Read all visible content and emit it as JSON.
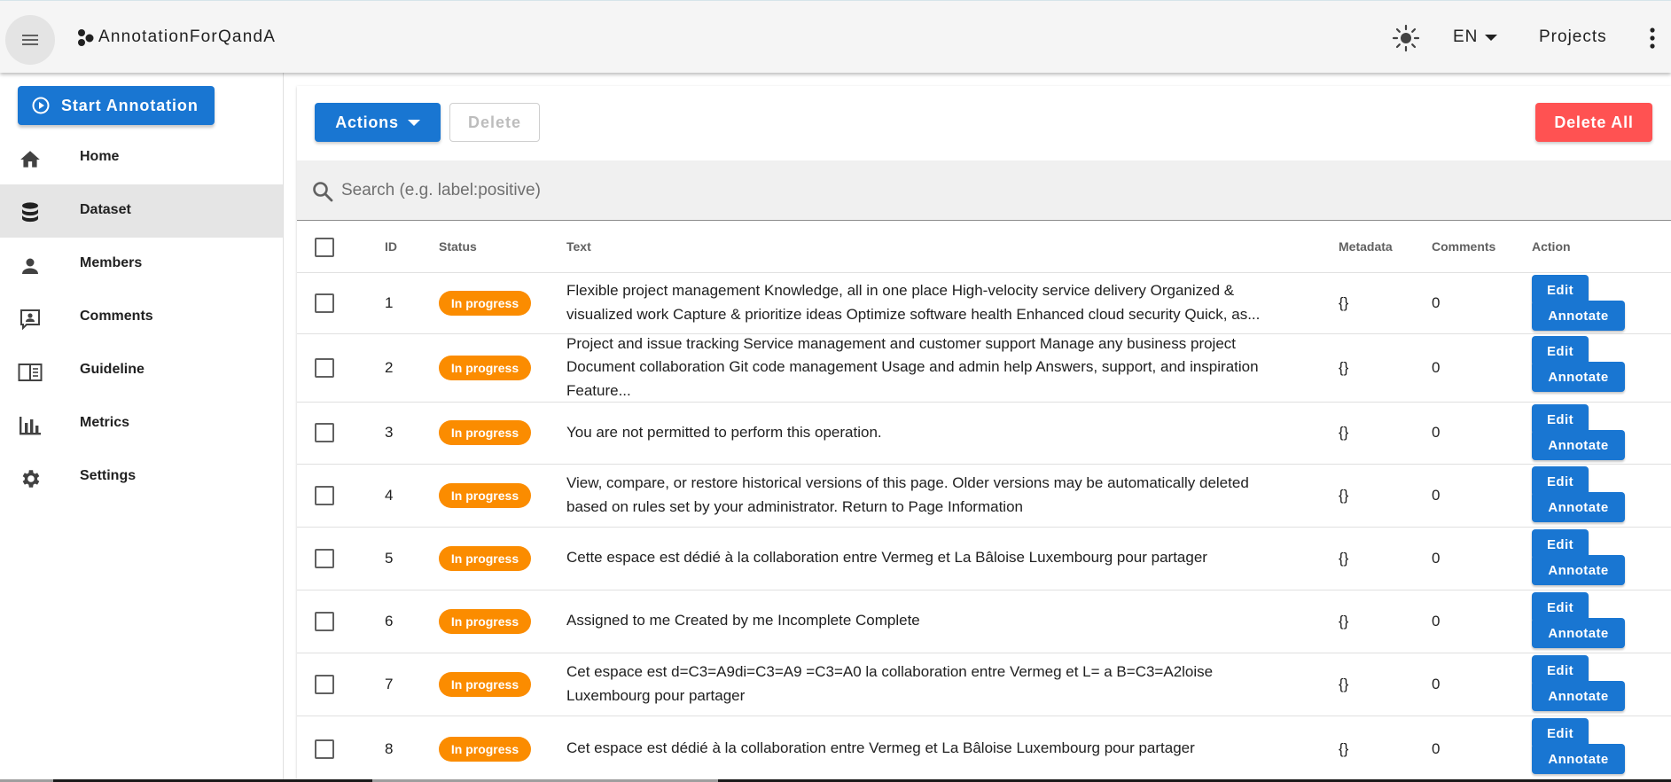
{
  "app": {
    "title": "AnnotationForQandA",
    "language": "EN",
    "projects_label": "Projects"
  },
  "sidebar": {
    "start_button": "Start Annotation",
    "items": [
      {
        "label": "Home",
        "icon": "home-icon"
      },
      {
        "label": "Dataset",
        "icon": "database-icon",
        "active": true
      },
      {
        "label": "Members",
        "icon": "person-icon"
      },
      {
        "label": "Comments",
        "icon": "comment-account-icon"
      },
      {
        "label": "Guideline",
        "icon": "book-open-icon"
      },
      {
        "label": "Metrics",
        "icon": "bar-chart-icon"
      },
      {
        "label": "Settings",
        "icon": "gear-icon"
      }
    ]
  },
  "toolbar": {
    "actions_label": "Actions",
    "delete_label": "Delete",
    "delete_all_label": "Delete All"
  },
  "search": {
    "placeholder": "Search (e.g. label:positive)",
    "value": ""
  },
  "table": {
    "columns": [
      "ID",
      "Status",
      "Text",
      "Metadata",
      "Comments",
      "Action"
    ],
    "edit_label": "Edit",
    "annotate_label": "Annotate",
    "rows": [
      {
        "id": "1",
        "status": "In progress",
        "text": "Flexible project management Knowledge, all in one place High-velocity service delivery Organized & visualized work Capture & prioritize ideas Optimize software health Enhanced cloud security Quick, as...",
        "metadata": "{}",
        "comments": "0"
      },
      {
        "id": "2",
        "status": "In progress",
        "text": "Project and issue tracking Service management and customer support Manage any business project Document collaboration Git code management Usage and admin help Answers, support, and inspiration Feature...",
        "metadata": "{}",
        "comments": "0"
      },
      {
        "id": "3",
        "status": "In progress",
        "text": "You are not permitted to perform this operation.",
        "metadata": "{}",
        "comments": "0"
      },
      {
        "id": "4",
        "status": "In progress",
        "text": "View, compare, or restore historical versions of this page. Older versions may be automatically deleted based on rules set by your administrator. Return to Page Information",
        "metadata": "{}",
        "comments": "0"
      },
      {
        "id": "5",
        "status": "In progress",
        "text": "Cette espace est dédié à la collaboration entre Vermeg et La Bâloise Luxembourg pour partager",
        "metadata": "{}",
        "comments": "0"
      },
      {
        "id": "6",
        "status": "In progress",
        "text": "Assigned to me Created by me Incomplete Complete",
        "metadata": "{}",
        "comments": "0"
      },
      {
        "id": "7",
        "status": "In progress",
        "text": "Cet espace est d=C3=A9di=C3=A9 =C3=A0 la collaboration entre Vermeg et L= a B=C3=A2loise Luxembourg pour partager",
        "metadata": "{}",
        "comments": "0"
      },
      {
        "id": "8",
        "status": "In progress",
        "text": "Cet espace est dédié à la collaboration entre Vermeg et La Bâloise Luxembourg pour partager",
        "metadata": "{}",
        "comments": "0"
      }
    ]
  },
  "colors": {
    "primary": "#1976d2",
    "status_in_progress": "#fb8c00",
    "danger": "#ff5252"
  }
}
